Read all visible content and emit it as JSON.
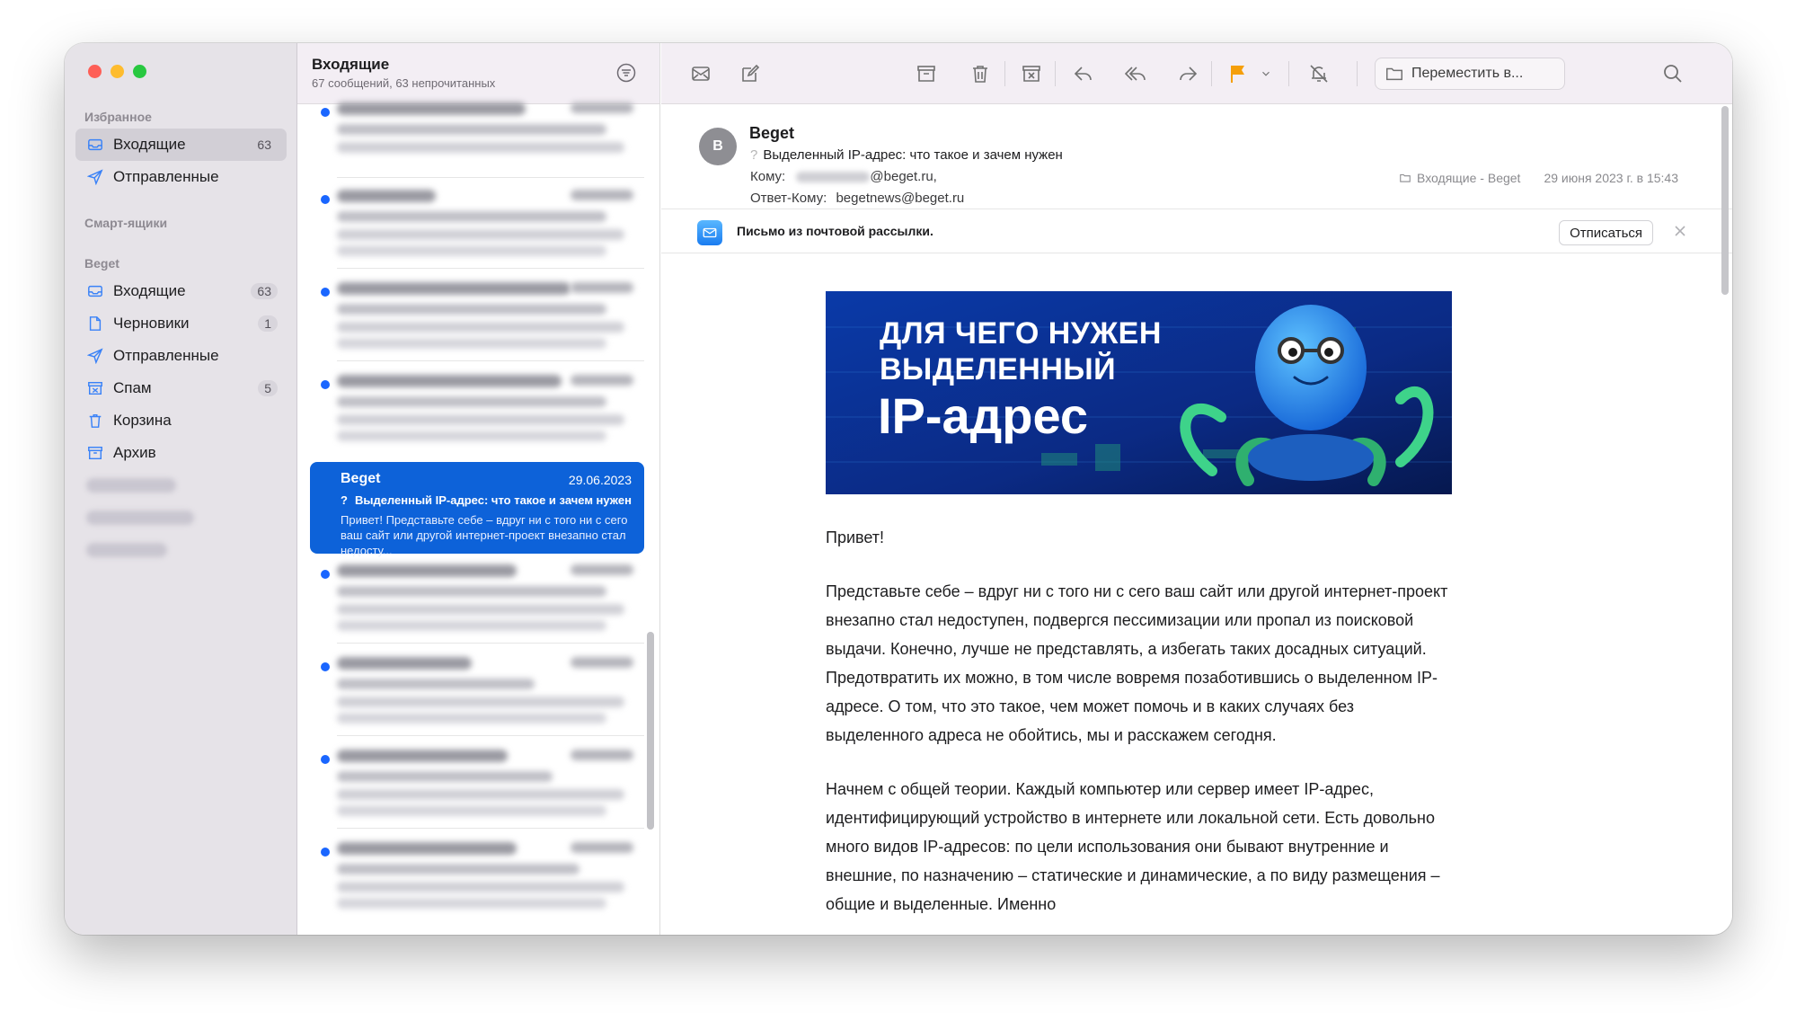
{
  "sidebar": {
    "favorites_title": "Избранное",
    "smart_title": "Смарт-ящики",
    "account_title": "Beget",
    "favorites": [
      {
        "label": "Входящие",
        "count": "63",
        "icon": "inbox-icon"
      },
      {
        "label": "Отправленные",
        "count": "",
        "icon": "sent-icon"
      }
    ],
    "account_items": [
      {
        "label": "Входящие",
        "count": "63",
        "icon": "inbox-icon"
      },
      {
        "label": "Черновики",
        "count": "1",
        "icon": "draft-icon"
      },
      {
        "label": "Отправленные",
        "count": "",
        "icon": "sent-icon"
      },
      {
        "label": "Спам",
        "count": "5",
        "icon": "spam-icon"
      },
      {
        "label": "Корзина",
        "count": "",
        "icon": "trash-icon"
      },
      {
        "label": "Архив",
        "count": "",
        "icon": "archive-icon"
      }
    ]
  },
  "list": {
    "title": "Входящие",
    "subtitle": "67 сообщений, 63 непрочитанных",
    "selected": {
      "from": "Beget",
      "date": "29.06.2023",
      "subject": "Выделенный IP-адрес: что такое и зачем нужен",
      "preview": "Привет! Представьте себе – вдруг ни с того ни с сего ваш сайт или другой интернет-проект внезапно стал недосту..."
    }
  },
  "toolbar": {
    "move_label": "Переместить в..."
  },
  "message": {
    "avatar_initial": "B",
    "from": "Beget",
    "subject_marker": "?",
    "subject": "Выделенный IP-адрес: что такое и зачем нужен",
    "to_label": "Кому:",
    "to_domain": "@beget.ru,",
    "reply_label": "Ответ-Кому:",
    "reply_address": "begetnews@beget.ru",
    "mailbox": "Входящие - Beget",
    "date": "29 июня 2023 г. в 15:43",
    "newsletter_note": "Письмо из почтовой рассылки.",
    "unsubscribe_label": "Отписаться",
    "hero_line1": "ДЛЯ ЧЕГО НУЖЕН",
    "hero_line2": "ВЫДЕЛЕННЫЙ",
    "hero_line3": "IP-адрес",
    "greeting": "Привет!",
    "paragraph1": "Представьте себе – вдруг ни с того ни с сего ваш сайт или другой интернет-проект внезапно стал недоступен, подвергся пессимизации или пропал из поисковой выдачи. Конечно, лучше не представлять, а избегать таких досадных ситуаций. Предотвратить их можно, в том числе вовремя позаботившись о выделенном IP-адресе. О том, что это такое, чем может помочь и в каких случаях без выделенного адреса не обойтись, мы и расскажем сегодня.",
    "paragraph2": "Начнем с общей теории. Каждый компьютер или сервер имеет IP-адрес, идентифицирующий устройство в интернете или локальной сети. Есть довольно много видов IP-адресов: по цели использования они бывают внутренние и внешние, по назначению – статические и динамические, а по виду размещения – общие и выделенные. Именно"
  },
  "colors": {
    "accent": "#0d62d9",
    "flag": "#f59f0a",
    "unread_dot": "#1a66ff"
  }
}
